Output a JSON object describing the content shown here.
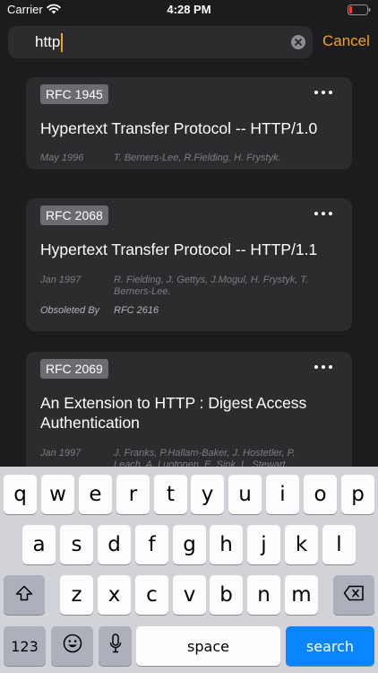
{
  "status": {
    "carrier": "Carrier",
    "time": "4:28 PM"
  },
  "search": {
    "query": "http",
    "cancel_label": "Cancel"
  },
  "results": [
    {
      "rfc": "RFC 1945",
      "title_lines": [
        "Hypertext Transfer Protocol -- HTTP/1.0"
      ],
      "date": "May 1996",
      "authors_lines": [
        "T. Berners-Lee, R.Fielding, H. Frystyk."
      ]
    },
    {
      "rfc": "RFC 2068",
      "title_lines": [
        "Hypertext Transfer Protocol -- HTTP/1.1"
      ],
      "date": "Jan 1997",
      "authors_lines": [
        "R. Fielding, J. Gettys, J.Mogul, H. Frystyk, T.",
        "Berners-Lee."
      ],
      "obsoleted_label": "Obsoleted By",
      "obsoleted_value": "RFC 2616"
    },
    {
      "rfc": "RFC 2069",
      "title_lines": [
        "An Extension to HTTP : Digest Access",
        "Authentication"
      ],
      "date": "Jan 1997",
      "authors_lines": [
        "J. Franks, P.Hallam-Baker, J. Hostetler, P.",
        "Leach, A. Luotonen, E. Sink, L. Stewart."
      ]
    }
  ],
  "keyboard": {
    "row1": [
      "q",
      "w",
      "e",
      "r",
      "t",
      "y",
      "u",
      "i",
      "o",
      "p"
    ],
    "row2": [
      "a",
      "s",
      "d",
      "f",
      "g",
      "h",
      "j",
      "k",
      "l"
    ],
    "row3": [
      "z",
      "x",
      "c",
      "v",
      "b",
      "n",
      "m"
    ],
    "numbers_label": "123",
    "space_label": "space",
    "search_label": "search"
  },
  "icons": {
    "wifi": "wifi-icon",
    "battery": "battery-low-icon",
    "clear": "clear-circle-icon",
    "more": "ellipsis-icon",
    "shift": "shift-arrow-icon",
    "backspace": "backspace-icon",
    "emoji": "emoji-icon",
    "mic": "microphone-icon"
  },
  "colors": {
    "accent": "#f4a21c",
    "battery_low": "#ff3b30",
    "search_key": "#0a84ff"
  }
}
